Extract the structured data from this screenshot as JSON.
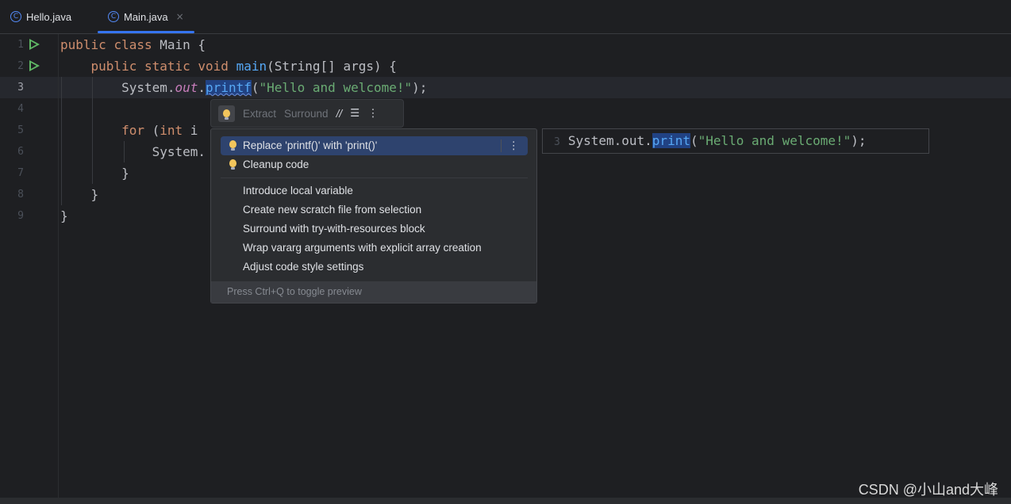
{
  "tabs": [
    {
      "icon": "c-class-icon",
      "icon_glyph": "C",
      "label": "Hello.java",
      "active": false
    },
    {
      "icon": "c-class-icon",
      "icon_glyph": "C",
      "label": "Main.java",
      "active": true,
      "close": "×"
    }
  ],
  "gutter": {
    "line_numbers": [
      "1",
      "2",
      "3",
      "4",
      "5",
      "6",
      "7",
      "8",
      "9"
    ],
    "current_line": "3"
  },
  "code": {
    "l1": {
      "kw1": "public",
      "kw2": "class",
      "rest": " Main {"
    },
    "l2": {
      "kw1": "public",
      "kw2": "static",
      "kw3": "void",
      "fn": "main",
      "rest": "(String[] args) {"
    },
    "l3": {
      "pre": "System.",
      "field": "out",
      "dot": ".",
      "method": "printf",
      "open": "(",
      "str": "\"Hello and welcome!\"",
      "close": ");"
    },
    "l5": {
      "kw": "for",
      "rest_a": " (",
      "kw2": "int",
      "rest_b": " i"
    },
    "l6": {
      "text": "System."
    },
    "l7": {
      "text": "}"
    },
    "l8": {
      "text": "}"
    },
    "l9": {
      "text": "}"
    }
  },
  "toolbar": {
    "extract": "Extract",
    "surround": "Surround",
    "comment_glyph": "//",
    "format_glyph": "☰",
    "more_glyph": "⋮"
  },
  "popup": {
    "items": [
      {
        "label": "Replace 'printf()' with 'print()'",
        "bulb": true,
        "selected": true
      },
      {
        "label": "Cleanup code",
        "bulb": true
      },
      {
        "label": "Introduce local variable"
      },
      {
        "label": "Create new scratch file from selection"
      },
      {
        "label": "Surround with try-with-resources block"
      },
      {
        "label": "Wrap vararg arguments with explicit array creation"
      },
      {
        "label": "Adjust code style settings"
      }
    ],
    "more_glyph": "⋮",
    "footer": "Press Ctrl+Q to toggle preview"
  },
  "preview": {
    "line_number": "3",
    "pre": "System.out.",
    "method": "print",
    "open": "(",
    "str": "\"Hello and welcome!\"",
    "close": ");"
  },
  "watermark": "CSDN @小山and大峰",
  "colors": {
    "background": "#1e1f22",
    "keyword": "#cf8e6d",
    "function": "#56a8f5",
    "string": "#6aab73",
    "field": "#c77dbb",
    "selection": "#214283",
    "accent": "#3574f0"
  }
}
